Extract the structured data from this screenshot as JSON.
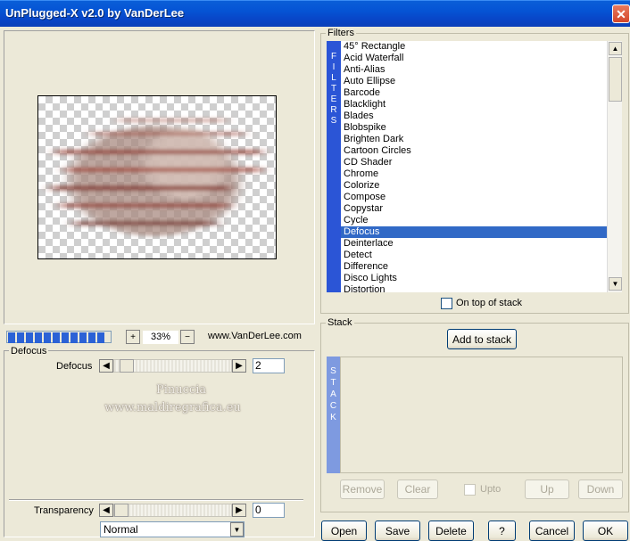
{
  "window": {
    "title": "UnPlugged-X v2.0 by VanDerLee",
    "close_symbol": "✕"
  },
  "filters": {
    "group_label": "Filters",
    "side_label": [
      "F",
      "I",
      "L",
      "T",
      "E",
      "R",
      "S"
    ],
    "items": [
      "45° Rectangle",
      "Acid Waterfall",
      "Anti-Alias",
      "Auto Ellipse",
      "Barcode",
      "Blacklight",
      "Blades",
      "Blobspike",
      "Brighten Dark",
      "Cartoon Circles",
      "CD Shader",
      "Chrome",
      "Colorize",
      "Compose",
      "Copystar",
      "Cycle",
      "Defocus",
      "Deinterlace",
      "Detect",
      "Difference",
      "Disco Lights",
      "Distortion"
    ],
    "selected": "Defocus",
    "on_top_label": "On top of stack"
  },
  "zoom": {
    "value": "33%",
    "plus": "+",
    "minus": "−",
    "website": "www.VanDerLee.com"
  },
  "defocus": {
    "group_label": "Defocus",
    "param_label": "Defocus",
    "value": "2",
    "slider_level": 0.05
  },
  "watermark": {
    "line1": "Pinuccia",
    "line2": "www.maldiregrafica.eu"
  },
  "transparency": {
    "label": "Transparency",
    "value": "0",
    "slider_level": 0.0
  },
  "blend_mode": {
    "value": "Normal"
  },
  "stack": {
    "group_label": "Stack",
    "add_label": "Add to stack",
    "side_label": [
      "S",
      "T",
      "A",
      "C",
      "K"
    ],
    "remove_label": "Remove",
    "clear_label": "Clear",
    "upto_label": "Upto",
    "up_label": "Up",
    "down_label": "Down"
  },
  "footer": {
    "open": "Open",
    "save": "Save",
    "delete": "Delete",
    "help": "?",
    "cancel": "Cancel",
    "ok": "OK"
  },
  "colors": {
    "titlebar": "#0553d4",
    "selection": "#3169c6",
    "filters_bar": "#2b55d6",
    "stack_bar": "#7e9ae0"
  }
}
